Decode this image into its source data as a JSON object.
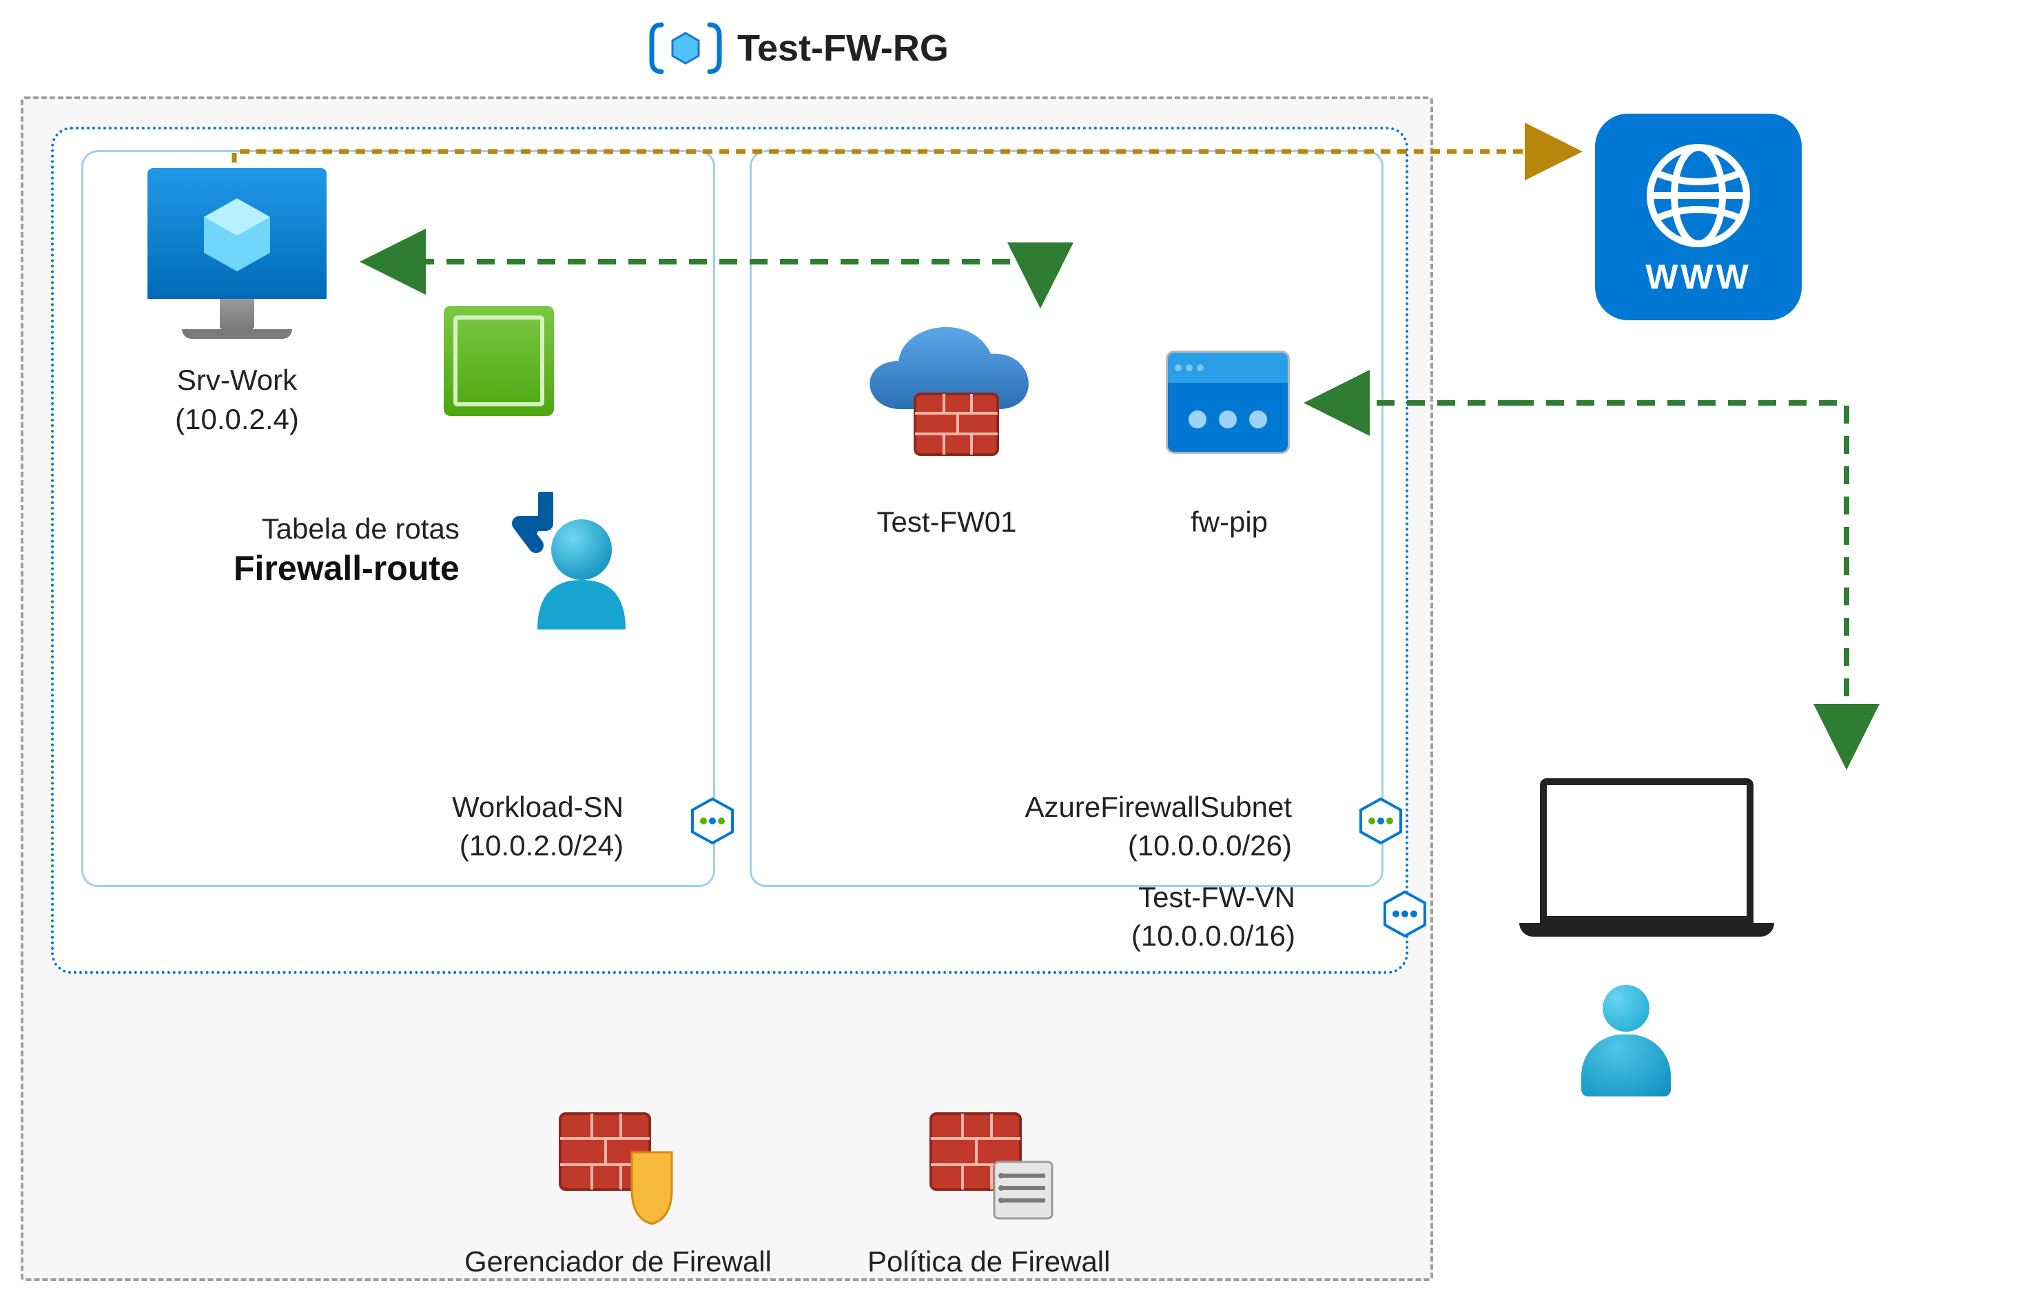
{
  "resource_group": {
    "title": "Test-FW-RG"
  },
  "vnet": {
    "name": "Test-FW-VN",
    "cidr": "(10.0.0.0/16)"
  },
  "subnets": {
    "workload": {
      "name": "Workload-SN",
      "cidr": "(10.0.2.0/24)"
    },
    "firewall": {
      "name": "AzureFirewallSubnet",
      "cidr": "(10.0.0.0/26)"
    }
  },
  "vm": {
    "name": "Srv-Work",
    "ip": "(10.0.2.4)"
  },
  "route_table": {
    "heading": "Tabela de rotas",
    "name": "Firewall-route"
  },
  "firewall": {
    "name": "Test-FW01"
  },
  "public_ip": {
    "name": "fw-pip"
  },
  "internet": {
    "label": "WWW"
  },
  "tools": {
    "firewall_manager": "Gerenciador de Firewall",
    "firewall_policy": "Política de Firewall"
  },
  "icons": {
    "resource_group": "resource-group-icon",
    "vm": "virtual-machine-icon",
    "nic": "network-interface-icon",
    "user": "user-icon",
    "firewall": "azure-firewall-icon",
    "public_ip": "public-ip-icon",
    "internet": "internet-globe-icon",
    "laptop": "laptop-icon",
    "subnet": "subnet-peering-icon",
    "vnet": "vnet-peering-icon",
    "route_table": "route-table-icon",
    "firewall_manager": "firewall-manager-icon",
    "firewall_policy": "firewall-policy-icon"
  },
  "colors": {
    "azure_blue": "#0078d4",
    "outline_grey": "#9e9e9e",
    "green_arrow": "#2e7d32",
    "gold_arrow": "#b8860b"
  }
}
